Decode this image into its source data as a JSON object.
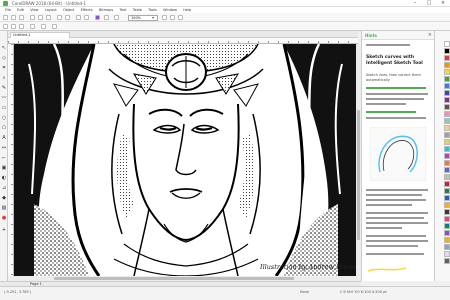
{
  "window": {
    "title": "CorelDRAW 2018 (64-Bit) - Untitled-1"
  },
  "menu": [
    "File",
    "Edit",
    "View",
    "Layout",
    "Object",
    "Effects",
    "Bitmaps",
    "Text",
    "Table",
    "Tools",
    "Window",
    "Help"
  ],
  "toolbar": {
    "zoom": "100%"
  },
  "document_tab": "Untitled-1",
  "signature": "Illustration by Andrew Brown",
  "panel": {
    "header": "Hints",
    "title": "Sketch curves with Intelligent Sketch Tool",
    "subtitle": "Sketch lines, then correct them automatically"
  },
  "status": {
    "page": "Page 1",
    "coords": "( 9.251, 3.765 )",
    "fill": "None",
    "outline": "C:0 M:0 Y:0 K:100  0.500 pt"
  },
  "palette": [
    "#ffffff",
    "#000000",
    "#e53935",
    "#fb8c00",
    "#fdd835",
    "#43a047",
    "#1e88e5",
    "#3949ab",
    "#8e24aa",
    "#6d4c41",
    "#f48fb1",
    "#80cbc4",
    "#ffcc80",
    "#9e9e9e",
    "#d4e157",
    "#26c6da",
    "#ab47bc",
    "#ff7043",
    "#5c6bc0",
    "#bdbdbd",
    "#c62828",
    "#2e7d32",
    "#1565c0",
    "#f9a825",
    "#4e342e",
    "#ec407a",
    "#00897b",
    "#7e57c2",
    "#ffab00",
    "#90a4ae",
    "#e0e0e0",
    "#616161"
  ]
}
